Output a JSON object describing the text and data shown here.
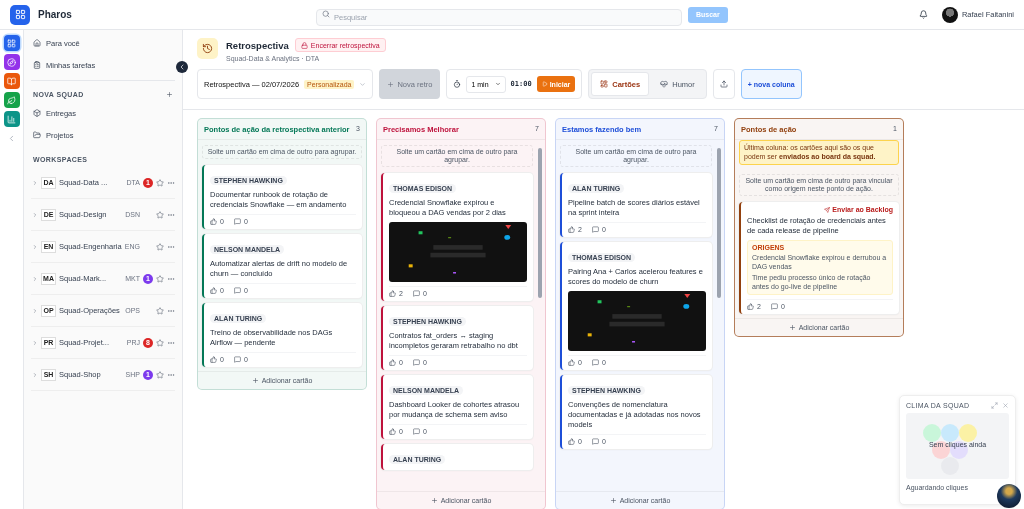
{
  "app": {
    "name": "Pharos"
  },
  "search": {
    "placeholder": "Pesquisar",
    "button": "Buscar"
  },
  "user": {
    "name": "Rafael Faitanini"
  },
  "rail": [
    {
      "color": "#2563eb",
      "selected": true
    },
    {
      "color": "#9333ea",
      "selected": false
    },
    {
      "color": "#ea580c",
      "selected": false
    },
    {
      "color": "#16a34a",
      "selected": false
    },
    {
      "color": "#0d9488",
      "selected": false
    }
  ],
  "sidebar": {
    "items": [
      "Para você",
      "Minhas tarefas"
    ],
    "squad_heading": "NOVA SQUAD",
    "squad_items": [
      "Entregas",
      "Projetos"
    ],
    "workspaces_heading": "WORKSPACES",
    "workspaces": [
      {
        "abbr": "DA",
        "name": "Squad-Data ...",
        "code": "DTA",
        "badge": "1",
        "color": "#dc2626"
      },
      {
        "abbr": "DE",
        "name": "Squad-Design",
        "code": "DSN"
      },
      {
        "abbr": "EN",
        "name": "Squad-Engenharia",
        "code": "ENG"
      },
      {
        "abbr": "MA",
        "name": "Squad-Mark...",
        "code": "MKT",
        "badge": "1",
        "color": "#7c3aed"
      },
      {
        "abbr": "OP",
        "name": "Squad-Operações",
        "code": "OPS"
      },
      {
        "abbr": "PR",
        "name": "Squad-Projet...",
        "code": "PRJ",
        "badge": "8",
        "color": "#dc2626"
      },
      {
        "abbr": "SH",
        "name": "Squad-Shop",
        "code": "SHP",
        "badge": "1",
        "color": "#7c3aed"
      }
    ]
  },
  "header": {
    "title": "Retrospectiva",
    "end_button": "Encerrar retrospectiva",
    "subtitle": "Squad-Data & Analytics · ",
    "subtitle_code": "DTA"
  },
  "toolbar": {
    "retro": "Retrospectiva — 02/07/2026",
    "retro_tag": "Personalizada",
    "new_retro": "Nova retro",
    "new_retro_disabled": true,
    "duration": "1 min",
    "timer": "01:00",
    "start": "Iniciar",
    "views": [
      {
        "label": "Cartões",
        "selected": true
      },
      {
        "label": "Humor",
        "selected": false
      }
    ],
    "new_column": "+ nova coluna"
  },
  "columns": [
    {
      "title": "Pontos de ação da retrospectiva anterior",
      "count": "3",
      "color": "#047857",
      "hint": "Solte um cartão em cima de outro para agrupar.",
      "scroll": false,
      "add": "Adicionar cartão",
      "cards": [
        {
          "author": "STEPHEN HAWKING",
          "text": "Documentar runbook de rotação de credenciais Snowflake — em andamento",
          "likes": "0",
          "comments": "0"
        },
        {
          "author": "NELSON MANDELA",
          "text": "Automatizar alertas de drift no modelo de churn — concluído",
          "likes": "0",
          "comments": "0"
        },
        {
          "author": "ALAN TURING",
          "text": "Treino de observabilidade nos DAGs Airflow — pendente",
          "likes": "0",
          "comments": "0"
        }
      ]
    },
    {
      "title": "Precisamos Melhorar",
      "count": "7",
      "color": "#be123c",
      "hint": "Solte um cartão em cima de outro para agrupar.",
      "scroll": true,
      "add": "Adicionar cartão",
      "cards": [
        {
          "author": "THOMAS EDISON",
          "text": "Credencial Snowflake expirou e bloqueou a DAG vendas por 2 dias",
          "picture": true,
          "likes": "2",
          "comments": "0"
        },
        {
          "author": "STEPHEN HAWKING",
          "text": "Contratos fat_orders ↔ staging incompletos geraram retrabalho no dbt",
          "likes": "0",
          "comments": "0"
        },
        {
          "author": "NELSON MANDELA",
          "text": "Dashboard Looker de cohortes atrasou por mudança de schema sem aviso",
          "likes": "0",
          "comments": "0"
        },
        {
          "author": "ALAN TURING"
        }
      ]
    },
    {
      "title": "Estamos fazendo bem",
      "count": "7",
      "color": "#1d4ed8",
      "hint": "Solte um cartão em cima de outro para agrupar.",
      "scroll": true,
      "add": "Adicionar cartão",
      "cards": [
        {
          "author": "ALAN TURING",
          "text": "Pipeline batch de scores diários estável na sprint inteira",
          "likes": "2",
          "comments": "0"
        },
        {
          "author": "THOMAS EDISON",
          "text": "Pairing Ana + Carlos acelerou features e scores do modelo de churn",
          "picture": true,
          "likes": "0",
          "comments": "0"
        },
        {
          "author": "STEPHEN HAWKING",
          "text": "Convenções de nomenclatura documentadas e já adotadas nos novos models",
          "likes": "0",
          "comments": "0"
        }
      ]
    },
    {
      "title": "Pontos de ação",
      "count": "1",
      "color": "#92400e",
      "note": "Última coluna: os cartões aqui são os que podem ser **enviados ao board da squad.**",
      "hint": "Solte um cartão em cima de outro para vincular como origem neste ponto de ação.",
      "scroll": false,
      "add": "Adicionar cartão",
      "cards": [
        {
          "action": "Enviar ao Backlog",
          "text": "Checklist de rotação de credenciais antes de cada release de pipeline",
          "origins_heading": "ORIGENS",
          "origins": [
            "Credencial Snowflake expirou e derrubou a DAG vendas",
            "Time pediu processo único de rotação antes do go-live de pipeline"
          ],
          "likes": "2",
          "comments": "0"
        }
      ]
    }
  ],
  "mood": {
    "title": "CLIMA DA SQUAD",
    "empty": "Sem cliques ainda",
    "status": "Aguardando cliques"
  }
}
